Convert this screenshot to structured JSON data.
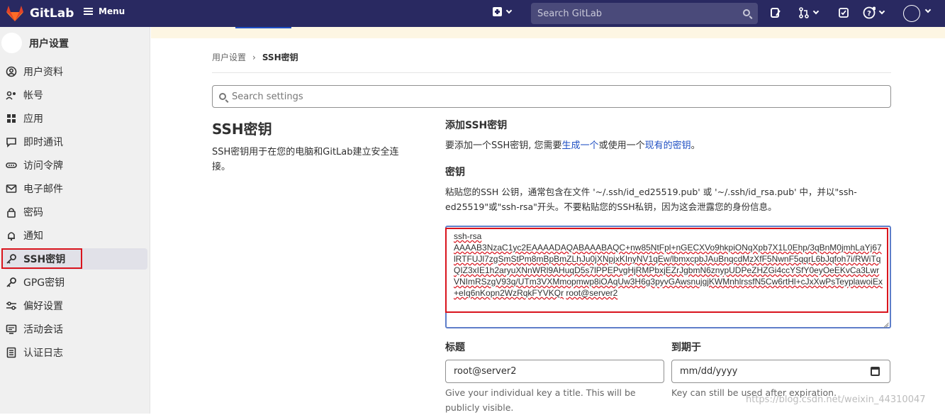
{
  "navbar": {
    "brand": "GitLab",
    "menu_label": "Menu",
    "search_placeholder": "Search GitLab"
  },
  "sidebar": {
    "title": "用户设置",
    "items": [
      {
        "label": "用户资料",
        "icon": "user-circle-icon"
      },
      {
        "label": "帐号",
        "icon": "user-gear-icon"
      },
      {
        "label": "应用",
        "icon": "grid-icon"
      },
      {
        "label": "即时通讯",
        "icon": "chat-bubble-icon"
      },
      {
        "label": "访问令牌",
        "icon": "token-icon"
      },
      {
        "label": "电子邮件",
        "icon": "envelope-icon"
      },
      {
        "label": "密码",
        "icon": "lock-icon"
      },
      {
        "label": "通知",
        "icon": "bell-icon"
      },
      {
        "label": "SSH密钥",
        "icon": "key-icon",
        "active": true
      },
      {
        "label": "GPG密钥",
        "icon": "key-icon"
      },
      {
        "label": "偏好设置",
        "icon": "sliders-icon"
      },
      {
        "label": "活动会话",
        "icon": "monitor-icon"
      },
      {
        "label": "认证日志",
        "icon": "list-icon"
      }
    ]
  },
  "breadcrumb": {
    "parent": "用户设置",
    "separator": "›",
    "current": "SSH密钥"
  },
  "settings_search": {
    "placeholder": "Search settings"
  },
  "section": {
    "title": "SSH密钥",
    "description": "SSH密钥用于在您的电脑和GitLab建立安全连接。"
  },
  "add_key": {
    "title": "添加SSH密钥",
    "desc_prefix": "要添加一个SSH密钥, 您需要",
    "link_generate": "生成一个",
    "desc_middle": "或使用一个",
    "link_existing": "现有的密钥",
    "desc_suffix": "。"
  },
  "key_field": {
    "label": "密钥",
    "help": "粘贴您的SSH 公钥，通常包含在文件 '~/.ssh/id_ed25519.pub' 或 '~/.ssh/id_rsa.pub' 中，并以\"ssh-ed25519\"或\"ssh-rsa\"开头。不要粘贴您的SSH私钥，因为这会泄露您的身份信息。",
    "value_type": "ssh-rsa",
    "value_key": "AAAAB3NzaC1yc2EAAAADAQABAAABAQC+nw85NtFpl+nGECXVo9hkpiONqXpb7X1L0Ehp/3qBnM0jmhLaYj67lRTFUJl7zgSmStPm8mBpBmZLhJu0jXNpjxKInyNV1qEw/lbmxcpbJAuBnqcdMzXfF5NwnF5qqrL6bJqfoh7i/RWiTqQIZ3xIE1h2aryuXNnWRl9AHuqD5s7lPPEPvgHjRMPbxjEZrJgbmN6znypUDPeZHZGi4ccYSfY0eyOeEKvCa3LwrVNImRSzgV93q/UTm3VXMmopmwp8iOAqUw3H6g3pyvGAwsnujgjKWMnhlrssfN5Cw6rtHl+cJxXwPsTeyplawoiEx+eIq6nKopn2WzRqkFYVKQr",
    "value_host": "root@server2"
  },
  "title_field": {
    "label": "标题",
    "value": "root@server2",
    "help": "Give your individual key a title. This will be publicly visible."
  },
  "expiry_field": {
    "label": "到期于",
    "placeholder": "mm/dd/yyyy",
    "help": "Key can still be used after expiration."
  },
  "watermark": "https://blog.csdn.net/weixin_44310047",
  "colors": {
    "navbar": "#292961",
    "link": "#1f4fc3",
    "highlight_red": "#d9141d"
  }
}
